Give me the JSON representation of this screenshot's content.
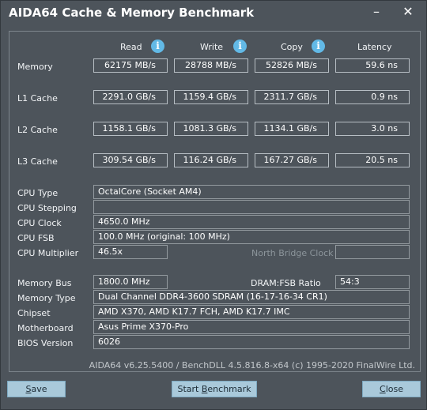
{
  "window": {
    "title": "AIDA64 Cache & Memory Benchmark",
    "minimize": "–",
    "close": "✕"
  },
  "columns": {
    "read": "Read",
    "write": "Write",
    "copy": "Copy",
    "latency": "Latency",
    "info": "i"
  },
  "rows": [
    {
      "label": "Memory",
      "read": "62175 MB/s",
      "write": "28788 MB/s",
      "copy": "52826 MB/s",
      "latency": "59.6 ns"
    },
    {
      "label": "L1 Cache",
      "read": "2291.0 GB/s",
      "write": "1159.4 GB/s",
      "copy": "2311.7 GB/s",
      "latency": "0.9 ns"
    },
    {
      "label": "L2 Cache",
      "read": "1158.1 GB/s",
      "write": "1081.3 GB/s",
      "copy": "1134.1 GB/s",
      "latency": "3.0 ns"
    },
    {
      "label": "L3 Cache",
      "read": "309.54 GB/s",
      "write": "116.24 GB/s",
      "copy": "167.27 GB/s",
      "latency": "20.5 ns"
    }
  ],
  "cpu": {
    "type_label": "CPU Type",
    "type_value": "OctalCore   (Socket AM4)",
    "stepping_label": "CPU Stepping",
    "stepping_value": "",
    "clock_label": "CPU Clock",
    "clock_value": "4650.0 MHz",
    "fsb_label": "CPU FSB",
    "fsb_value": "100.0 MHz  (original: 100 MHz)",
    "multiplier_label": "CPU Multiplier",
    "multiplier_value": "46.5x",
    "nb_clock_label": "North Bridge Clock",
    "nb_clock_value": ""
  },
  "memory": {
    "bus_label": "Memory Bus",
    "bus_value": "1800.0 MHz",
    "ratio_label": "DRAM:FSB Ratio",
    "ratio_value": "54:3",
    "type_label": "Memory Type",
    "type_value": "Dual Channel DDR4-3600 SDRAM  (16-17-16-34 CR1)",
    "chipset_label": "Chipset",
    "chipset_value": "AMD X370, AMD K17.7 FCH, AMD K17.7 IMC",
    "board_label": "Motherboard",
    "board_value": "Asus Prime X370-Pro",
    "bios_label": "BIOS Version",
    "bios_value": "6026"
  },
  "footer": "AIDA64 v6.25.5400 / BenchDLL 4.5.816.8-x64  (c) 1995-2020 FinalWire Ltd.",
  "buttons": {
    "save_u": "S",
    "save_rest": "ave",
    "start_pre": "Start ",
    "start_u": "B",
    "start_rest": "enchmark",
    "close_u": "C",
    "close_rest": "lose"
  }
}
